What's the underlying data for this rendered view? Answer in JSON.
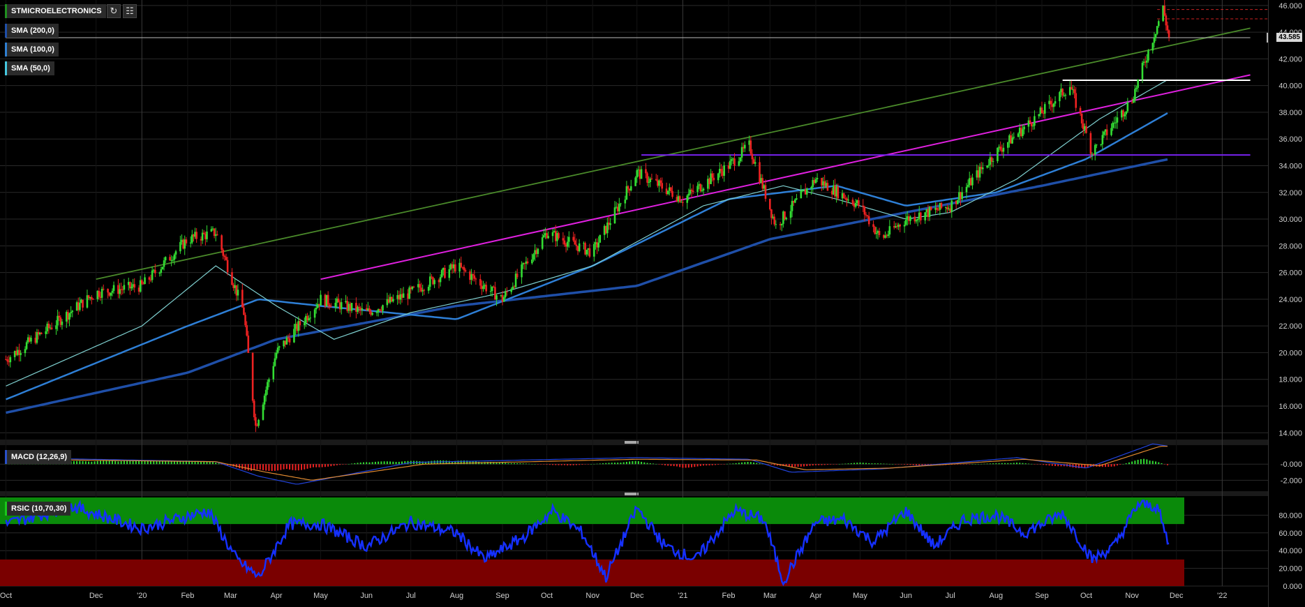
{
  "legend": {
    "symbol": "STMICROELECTRONICS",
    "sma200": "SMA (200,0)",
    "sma100": "SMA (100,0)",
    "sma50": "SMA (50,0)",
    "macd": "MACD (12,26,9)",
    "rsi": "RSIC (10,70,30)"
  },
  "toolbar": {
    "refresh_icon": "refresh-icon",
    "settings_icon": "chart-settings-icon"
  },
  "last_price": "43.585",
  "colors": {
    "up": "#33dd33",
    "down": "#ee2222",
    "sma50": "#7fd0d0",
    "sma100": "#2e7fd6",
    "sma200": "#1f4fa8",
    "trend_green": "#4a8a2a",
    "trend_magenta": "#e020e0",
    "support_purple": "#7722ee",
    "resistance_white": "#ffffff",
    "rsi_line": "#1530ff",
    "rsi_overbought": "#0a8a0a",
    "rsi_oversold": "#7a0000"
  },
  "chart_data": [
    {
      "type": "candlestick",
      "title": "STMICROELECTRONICS",
      "x_ticks": [
        "Oct",
        "Dec",
        "'20",
        "Feb",
        "Mar",
        "Apr",
        "May",
        "Jun",
        "Jul",
        "Aug",
        "Sep",
        "Oct",
        "Nov",
        "Dec",
        "'21",
        "Feb",
        "Mar",
        "Apr",
        "May",
        "Jun",
        "Jul",
        "Aug",
        "Sep",
        "Oct",
        "Nov",
        "Dec",
        "'22"
      ],
      "y_ticks": [
        "46.000",
        "44.000",
        "42.000",
        "40.000",
        "38.000",
        "36.000",
        "34.000",
        "32.000",
        "30.000",
        "28.000",
        "26.000",
        "24.000",
        "22.000",
        "20.000",
        "18.000",
        "16.000",
        "14.000"
      ],
      "ylim": [
        13.7,
        46.2
      ],
      "close_path": {
        "x": [
          "2019-10-01",
          "2019-11-01",
          "2019-12-01",
          "2020-01-01",
          "2020-02-01",
          "2020-02-20",
          "2020-03-10",
          "2020-03-18",
          "2020-04-01",
          "2020-05-01",
          "2020-06-01",
          "2020-07-01",
          "2020-08-01",
          "2020-09-01",
          "2020-10-01",
          "2020-11-01",
          "2020-12-01",
          "2021-01-01",
          "2021-02-01",
          "2021-02-15",
          "2021-03-05",
          "2021-04-01",
          "2021-05-01",
          "2021-05-15",
          "2021-06-01",
          "2021-07-01",
          "2021-08-01",
          "2021-09-01",
          "2021-09-20",
          "2021-10-05",
          "2021-11-01",
          "2021-11-22",
          "2021-11-26"
        ],
        "y": [
          19.5,
          22.0,
          24.5,
          25.0,
          28.5,
          29.0,
          23.0,
          14.5,
          20.0,
          24.0,
          23.0,
          24.5,
          26.5,
          24.0,
          29.0,
          27.5,
          33.5,
          31.5,
          34.0,
          35.5,
          29.5,
          33.0,
          31.0,
          28.5,
          30.0,
          31.0,
          35.0,
          38.0,
          40.0,
          35.0,
          39.0,
          45.8,
          43.585
        ]
      },
      "series": [
        {
          "name": "SMA (200,0)",
          "x": [
            "2019-10-01",
            "2020-02-01",
            "2020-04-01",
            "2020-08-01",
            "2020-12-01",
            "2021-03-01",
            "2021-06-01",
            "2021-09-01",
            "2021-11-26"
          ],
          "y": [
            15.5,
            18.5,
            21.0,
            23.5,
            25.0,
            28.5,
            30.5,
            32.5,
            34.5
          ]
        },
        {
          "name": "SMA (100,0)",
          "x": [
            "2019-10-01",
            "2020-02-01",
            "2020-03-20",
            "2020-05-01",
            "2020-08-01",
            "2020-11-01",
            "2021-02-01",
            "2021-04-15",
            "2021-06-01",
            "2021-08-01",
            "2021-10-01",
            "2021-11-26"
          ],
          "y": [
            16.5,
            22.0,
            24.0,
            23.5,
            22.5,
            26.5,
            31.5,
            32.5,
            31.0,
            32.0,
            34.5,
            38.0
          ]
        },
        {
          "name": "SMA (50,0)",
          "x": [
            "2019-10-01",
            "2020-01-01",
            "2020-02-20",
            "2020-04-01",
            "2020-05-10",
            "2020-07-01",
            "2020-09-01",
            "2020-11-01",
            "2021-01-15",
            "2021-03-10",
            "2021-04-15",
            "2021-06-01",
            "2021-07-01",
            "2021-08-15",
            "2021-10-10",
            "2021-11-26"
          ],
          "y": [
            17.5,
            22.0,
            26.5,
            23.5,
            21.0,
            23.0,
            24.5,
            26.5,
            31.0,
            32.5,
            31.5,
            30.0,
            30.5,
            33.0,
            37.5,
            40.5
          ]
        }
      ],
      "lines": [
        {
          "name": "green trendline",
          "x": [
            "2019-12-01",
            "2022-01-20"
          ],
          "y": [
            25.5,
            44.3
          ]
        },
        {
          "name": "magenta trendline",
          "x": [
            "2020-05-01",
            "2022-01-20"
          ],
          "y": [
            25.5,
            40.8
          ]
        },
        {
          "name": "purple support",
          "x": [
            "2020-12-04",
            "2022-01-20"
          ],
          "y": [
            34.8,
            34.8
          ]
        },
        {
          "name": "white resistance",
          "x": [
            "2021-09-15",
            "2022-01-20"
          ],
          "y": [
            40.4,
            40.4
          ]
        },
        {
          "name": "white price line",
          "x": [
            "2019-10-01",
            "2022-01-20"
          ],
          "y": [
            43.585,
            43.585
          ]
        }
      ]
    },
    {
      "type": "bar",
      "title": "MACD (12,26,9)",
      "y_ticks": [
        "-0.000",
        "-2.000"
      ],
      "ylim": [
        -3.0,
        2.0
      ],
      "histogram": {
        "x": [
          "2019-10-15",
          "2020-01-01",
          "2020-02-15",
          "2020-03-15",
          "2020-04-15",
          "2020-06-01",
          "2020-08-01",
          "2020-10-15",
          "2020-12-01",
          "2021-01-01",
          "2021-02-15",
          "2021-03-15",
          "2021-05-01",
          "2021-06-15",
          "2021-08-15",
          "2021-09-25",
          "2021-10-20",
          "2021-11-10",
          "2021-11-26"
        ],
        "y": [
          0.3,
          0.5,
          0.4,
          -0.9,
          -0.8,
          0.3,
          0.5,
          -0.2,
          0.4,
          -0.5,
          0.3,
          -0.4,
          0.2,
          -0.2,
          0.2,
          -0.5,
          -0.3,
          0.8,
          -0.2
        ]
      },
      "series": [
        {
          "name": "MACD",
          "x": [
            "2019-10-01",
            "2020-02-20",
            "2020-03-20",
            "2020-04-15",
            "2020-07-01",
            "2020-12-01",
            "2021-02-15",
            "2021-03-15",
            "2021-05-15",
            "2021-08-15",
            "2021-10-01",
            "2021-11-15",
            "2021-11-26"
          ],
          "y": [
            0.8,
            0.3,
            -1.5,
            -2.5,
            0.2,
            0.8,
            0.6,
            -1.0,
            -0.6,
            0.8,
            -0.5,
            2.5,
            2.2
          ]
        },
        {
          "name": "Signal",
          "x": [
            "2019-10-01",
            "2020-02-20",
            "2020-03-25",
            "2020-04-25",
            "2020-07-10",
            "2020-12-01",
            "2021-02-20",
            "2021-03-25",
            "2021-05-20",
            "2021-08-20",
            "2021-10-10",
            "2021-11-20",
            "2021-11-26"
          ],
          "y": [
            0.6,
            0.3,
            -1.0,
            -2.0,
            0.0,
            0.6,
            0.5,
            -0.7,
            -0.5,
            0.6,
            -0.2,
            2.2,
            2.2
          ]
        }
      ]
    },
    {
      "type": "line",
      "title": "RSIC (10,70,30)",
      "y_ticks": [
        "80.000",
        "60.000",
        "40.000",
        "20.000",
        "0.000"
      ],
      "ylim": [
        0,
        100
      ],
      "bands": {
        "overbought": 70,
        "oversold": 30
      },
      "series": [
        {
          "name": "RSI",
          "x": [
            "2019-10-01",
            "2019-11-15",
            "2020-01-01",
            "2020-02-15",
            "2020-03-05",
            "2020-03-20",
            "2020-04-10",
            "2020-05-01",
            "2020-06-01",
            "2020-07-01",
            "2020-08-01",
            "2020-08-20",
            "2020-09-15",
            "2020-10-05",
            "2020-10-25",
            "2020-11-10",
            "2020-12-01",
            "2020-12-20",
            "2021-01-10",
            "2021-02-05",
            "2021-02-25",
            "2021-03-10",
            "2021-04-01",
            "2021-04-20",
            "2021-05-10",
            "2021-06-01",
            "2021-06-20",
            "2021-07-10",
            "2021-08-01",
            "2021-08-20",
            "2021-09-15",
            "2021-10-05",
            "2021-10-20",
            "2021-11-05",
            "2021-11-18",
            "2021-11-26"
          ],
          "y": [
            70,
            90,
            65,
            85,
            30,
            10,
            70,
            70,
            45,
            72,
            60,
            30,
            55,
            85,
            60,
            10,
            88,
            45,
            30,
            85,
            75,
            5,
            72,
            75,
            50,
            85,
            45,
            75,
            80,
            60,
            82,
            30,
            45,
            92,
            90,
            45
          ]
        }
      ]
    }
  ]
}
